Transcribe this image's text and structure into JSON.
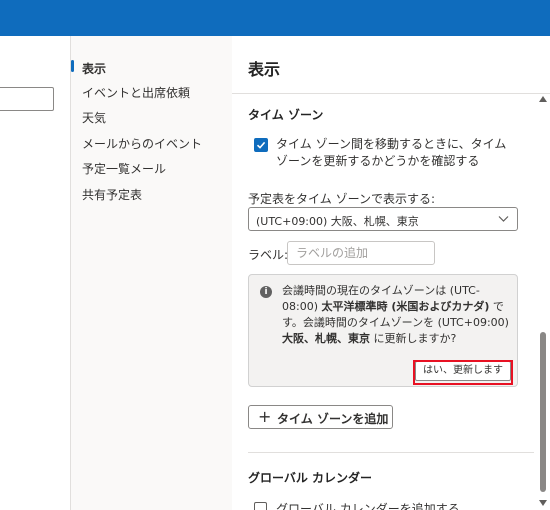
{
  "nav": {
    "items": [
      {
        "label": "表示",
        "selected": true
      },
      {
        "label": "イベントと出席依頼",
        "selected": false
      },
      {
        "label": "天気",
        "selected": false
      },
      {
        "label": "メールからのイベント",
        "selected": false
      },
      {
        "label": "予定一覧メール",
        "selected": false
      },
      {
        "label": "共有予定表",
        "selected": false
      }
    ]
  },
  "panel": {
    "title": "表示",
    "timezone": {
      "heading": "タイム ゾーン",
      "checkbox_label": "タイム ゾーン間を移動するときに、タイム ゾーンを更新するかどうかを確認する",
      "checkbox_checked": true,
      "display_label": "予定表をタイム ゾーンで表示する:",
      "dropdown_value": "(UTC+09:00) 大阪、札幌、東京",
      "label_label": "ラベル:",
      "label_placeholder": "ラベルの追加",
      "info": {
        "t1": "会議時間の現在のタイムゾーンは (UTC-08:00) ",
        "b1": "太平洋標準時 (米国およびカナダ)",
        "t2": " です。会議時間のタイムゾーンを (UTC+09:00) ",
        "b2": "大阪、札幌、東京",
        "t3": " に更新しますか?",
        "yes_button": "はい、更新します"
      },
      "add_button": "タイム ゾーンを追加"
    },
    "global_calendar": {
      "heading": "グローバル カレンダー",
      "checkbox_label": "グローバル カレンダーを追加する",
      "checkbox_checked": false
    }
  },
  "colors": {
    "brand": "#0f6cbd",
    "highlight": "#e81123"
  }
}
